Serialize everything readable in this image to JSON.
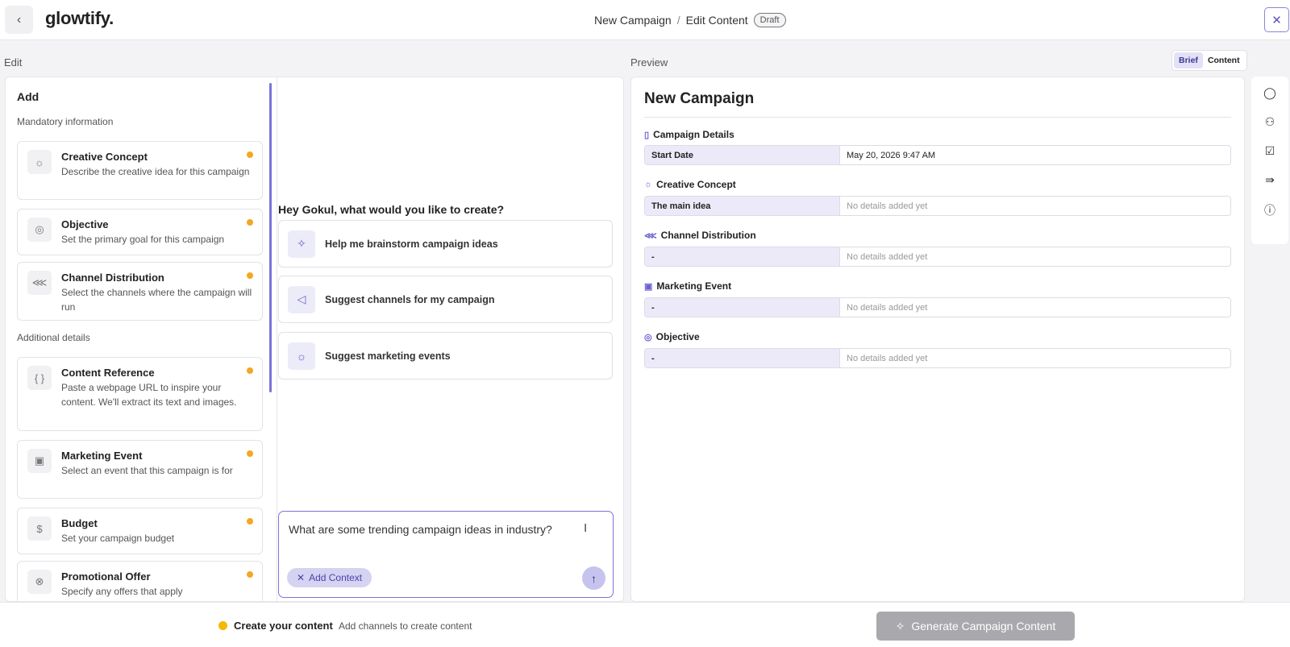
{
  "header": {
    "logo": "glowtify.",
    "breadcrumb": [
      "New Campaign",
      "Edit Content"
    ],
    "separator": "/",
    "status_badge": "Draft"
  },
  "edit": {
    "section_label": "Edit",
    "add_title": "Add",
    "mandatory_label": "Mandatory information",
    "additional_label": "Additional details",
    "mandatory_items": [
      {
        "title": "Creative Concept",
        "desc": "Describe the creative idea for this campaign",
        "icon": "lightbulb-icon"
      },
      {
        "title": "Objective",
        "desc": "Set the primary goal for this campaign",
        "icon": "target-icon"
      },
      {
        "title": "Channel Distribution",
        "desc": "Select the channels where the campaign will run",
        "icon": "share-icon"
      }
    ],
    "additional_items": [
      {
        "title": "Content Reference",
        "desc": "Paste a webpage URL to inspire your content. We'll extract its text and images.",
        "icon": "braces-icon"
      },
      {
        "title": "Marketing Event",
        "desc": "Select an event that this campaign is for",
        "icon": "calendar-icon"
      },
      {
        "title": "Budget",
        "desc": "Set your campaign budget",
        "icon": "dollar-icon"
      },
      {
        "title": "Promotional Offer",
        "desc": "Specify any offers that apply",
        "icon": "offer-icon"
      }
    ]
  },
  "assistant": {
    "greeting": "Hey Gokul, what would you like to create?",
    "suggestions": [
      {
        "label": "Help me brainstorm campaign ideas",
        "icon": "sparkle-icon"
      },
      {
        "label": "Suggest channels for my campaign",
        "icon": "megaphone-icon"
      },
      {
        "label": "Suggest marketing events",
        "icon": "lightbulb-icon"
      }
    ],
    "prompt_value": "What are some trending campaign ideas in industry?",
    "add_context_label": "Add Context"
  },
  "preview": {
    "section_label": "Preview",
    "toggle": {
      "brief": "Brief",
      "content": "Content"
    },
    "title": "New Campaign",
    "sections": [
      {
        "heading": "Campaign Details",
        "icon": "document-icon",
        "key": "Start Date",
        "value": "May 20, 2026 9:47 AM"
      },
      {
        "heading": "Creative Concept",
        "icon": "lightbulb-icon",
        "key": "The main idea",
        "value": "No details added yet"
      },
      {
        "heading": "Channel Distribution",
        "icon": "share-icon",
        "key": "-",
        "value": "No details added yet"
      },
      {
        "heading": "Marketing Event",
        "icon": "calendar-icon",
        "key": "-",
        "value": "No details added yet"
      },
      {
        "heading": "Objective",
        "icon": "target-icon",
        "key": "-",
        "value": "No details added yet"
      }
    ]
  },
  "rail_icons": [
    "comment-icon",
    "user-icon",
    "checkbox-icon",
    "share-arrow-icon",
    "info-icon"
  ],
  "footer": {
    "title": "Create your content",
    "subtitle": "Add channels to create content",
    "generate_label": "Generate Campaign Content"
  },
  "colors": {
    "accent": "#7b74d9",
    "status_dot": "#f5a623",
    "generate_disabled": "#a9a9ad"
  }
}
